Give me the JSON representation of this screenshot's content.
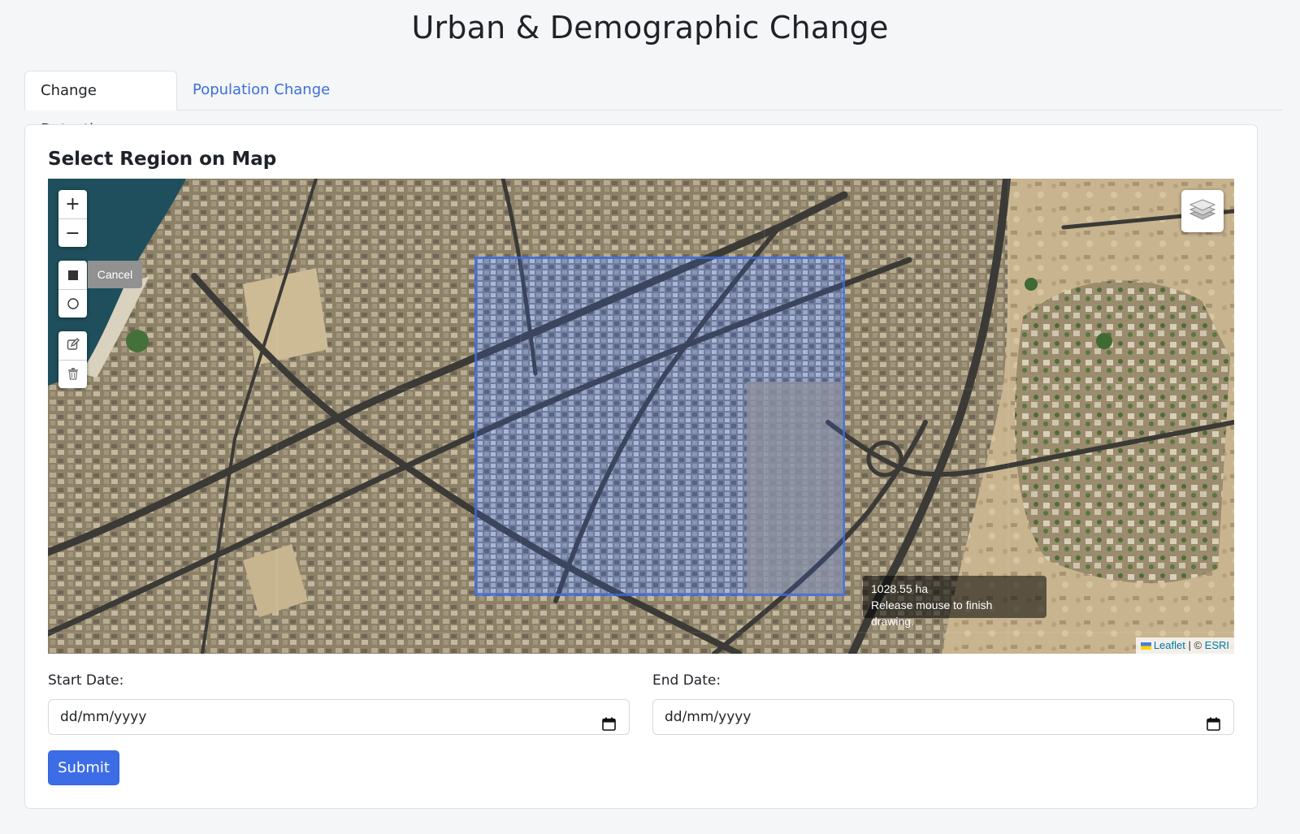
{
  "page": {
    "title": "Urban & Demographic Change"
  },
  "tabs": [
    {
      "label": "Change Detection",
      "active": true
    },
    {
      "label": "Population Change",
      "active": false
    }
  ],
  "section": {
    "title": "Select Region on Map"
  },
  "map": {
    "zoom_in_label": "+",
    "zoom_out_label": "−",
    "draw_tools": [
      "rectangle-icon",
      "circle-icon"
    ],
    "edit_tools": [
      "edit-icon",
      "trash-icon"
    ],
    "cancel_label": "Cancel",
    "layers_icon": "layers-icon",
    "selection_color": "#3b6ce6",
    "tooltip": {
      "area": "1028.55 ha",
      "hint": "Release mouse to finish drawing."
    },
    "attribution": {
      "leaflet": "Leaflet",
      "separator": " | © ",
      "provider": "ESRI"
    }
  },
  "form": {
    "start_label": "Start Date:",
    "start_placeholder": "dd/mm/yyyy",
    "end_label": "End Date:",
    "end_placeholder": "dd/mm/yyyy",
    "submit_label": "Submit"
  },
  "colors": {
    "accent": "#3d6de6",
    "tab_link": "#3b6fd9"
  }
}
